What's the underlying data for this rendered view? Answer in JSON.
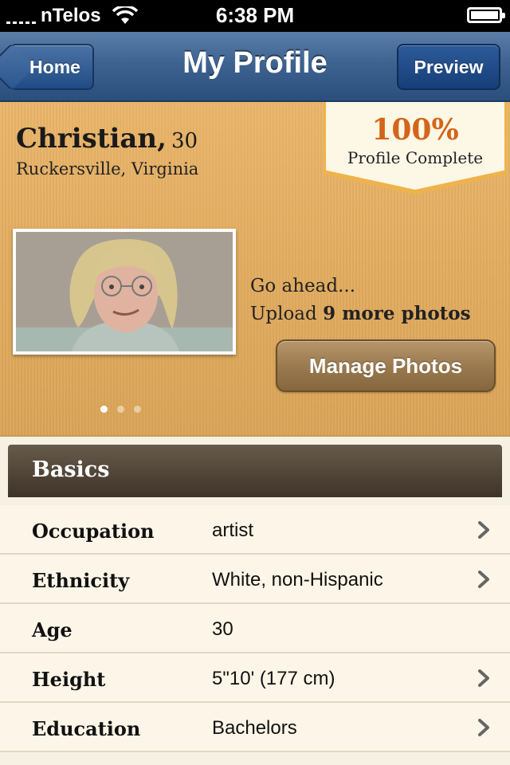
{
  "status_bar": {
    "carrier": "nTelos",
    "time": "6:38 PM"
  },
  "nav": {
    "back_label": "Home",
    "title": "My Profile",
    "preview_label": "Preview"
  },
  "profile": {
    "name": "Christian,",
    "age": "30",
    "location": "Ruckersville, Virginia",
    "badge_percent": "100%",
    "badge_label": "Profile Complete",
    "upload_line1": "Go ahead...",
    "upload_prefix": "Upload ",
    "upload_bold": "9 more photos",
    "manage_photos_label": "Manage Photos"
  },
  "basics": {
    "title": "Basics",
    "rows": [
      {
        "label": "Occupation",
        "value": "artist",
        "chevron": true
      },
      {
        "label": "Ethnicity",
        "value": "White, non-Hispanic",
        "chevron": true
      },
      {
        "label": "Age",
        "value": "30",
        "chevron": false
      },
      {
        "label": "Height",
        "value": "5\"10' (177 cm)",
        "chevron": true
      },
      {
        "label": "Education",
        "value": "Bachelors",
        "chevron": true
      }
    ]
  },
  "icons": {
    "signal": "signal-icon",
    "wifi": "wifi-icon",
    "battery": "battery-icon",
    "chevron": "chevron-right-icon"
  },
  "colors": {
    "nav_blue": "#3e6391",
    "header_tan": "#e2ac5f",
    "badge_orange": "#d3651a",
    "section_brown": "#4f4336",
    "row_bg": "#fdf6e8"
  }
}
